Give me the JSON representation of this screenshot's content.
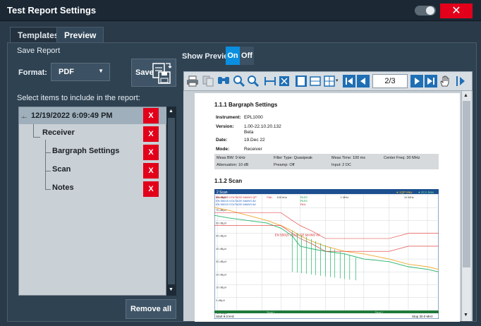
{
  "window": {
    "title": "Test Report Settings",
    "close_label": "✕"
  },
  "tabs": [
    {
      "label": "Templates"
    },
    {
      "label": "Preview"
    }
  ],
  "save_report": {
    "group_label": "Save Report",
    "format_label": "Format:",
    "format_value": "PDF",
    "save_label": "Save"
  },
  "items": {
    "label": "Select items to include in the report:",
    "tree": [
      {
        "label": "12/19/2022 6:09:49 PM",
        "remove": "X"
      },
      {
        "label": "Receiver",
        "remove": "X"
      },
      {
        "label": "Bargraph Settings",
        "remove": "X"
      },
      {
        "label": "Scan",
        "remove": "X"
      },
      {
        "label": "Notes",
        "remove": "X"
      }
    ],
    "remove_all_label": "Remove all"
  },
  "preview": {
    "show_preview_label": "Show Preview",
    "toggle_on": "On",
    "toggle_off": "Off",
    "page_counter": "2/3"
  },
  "document": {
    "section1_title": "1.1.1  Bargraph Settings",
    "instrument_label": "Instrument:",
    "instrument_value": "EPL1000",
    "version_label": "Version:",
    "version_value": "1.00-22.10.20.132",
    "version_value2": "Beta",
    "date_label": "Date:",
    "date_value": "19.Dec 22",
    "mode_label": "Mode:",
    "mode_value": "Receiver",
    "params": {
      "meas_bw": "Meas BW: 9 kHz",
      "filter": "Filter Type: Quasipeak",
      "meas_time": "Meas Time: 100 ms",
      "center": "Center Freq: 30 MHz",
      "atten": "Attenuation: 10 dB",
      "preamp": "Preamp: Off",
      "input": "Input: 2 DC"
    },
    "section2_title": "1.1.2  Scan"
  },
  "chart_data": {
    "type": "line",
    "title": "2 Scan",
    "legend": [
      "1QP Max",
      "2CA Max"
    ],
    "legend_placement": "top-right",
    "limit_lines": [
      {
        "name": "EN 55015 VOLTAGE MAINS QP",
        "status": "PASS"
      },
      {
        "name": "EN 55015 VOLTAGE MAINS AV",
        "status": "PASS"
      },
      {
        "name": "EN 55015 VOLTAGE MAINS AV",
        "status": "FAIL"
      }
    ],
    "limit_fail_label": "FAIL",
    "annotation": "EN 55015 VOLTAGE MAINS AV",
    "marker_labels": [
      "100 kHz",
      "1 MHz",
      "10 MHz"
    ],
    "y_tick_labels": [
      "80 dBµV",
      "70 dBµV",
      "60 dBµV",
      "50 dBµV",
      "40 dBµV",
      "30 dBµV",
      "20 dBµV",
      "10 dBµV",
      "0 dBµV",
      "-10 dBµV"
    ],
    "ylim": [
      -10,
      80
    ],
    "start_label": "Start 9.0 kHz",
    "stop_label": "Stop 30.0 MHz",
    "range_labels": [
      "Range 1",
      "Range 2"
    ],
    "x": [
      9,
      15,
      30,
      60,
      100,
      150,
      200,
      300,
      500,
      1000,
      2000,
      5000,
      10000,
      20000,
      30000
    ],
    "series": [
      {
        "name": "1QP Max",
        "color": "#f0a830",
        "values": [
          70,
          68,
          64,
          60,
          56,
          52,
          48,
          44,
          40,
          36,
          34,
          30,
          26,
          24,
          22
        ]
      },
      {
        "name": "2CA Max",
        "color": "#22b36a",
        "values": [
          64,
          62,
          60,
          58,
          54,
          48,
          40,
          38,
          36,
          34,
          30,
          28,
          24,
          22,
          20
        ]
      },
      {
        "name": "EN 55015 VOLTAGE MAINS QP",
        "color": "#e03030",
        "values": [
          66,
          66,
          66,
          66,
          66,
          60,
          56,
          52,
          46,
          46,
          46,
          46,
          50,
          50,
          50
        ]
      },
      {
        "name": "EN 55015 VOLTAGE MAINS AV",
        "color": "#e03030",
        "values": [
          56,
          56,
          56,
          56,
          56,
          50,
          46,
          42,
          36,
          36,
          36,
          36,
          40,
          40,
          40
        ]
      }
    ]
  }
}
